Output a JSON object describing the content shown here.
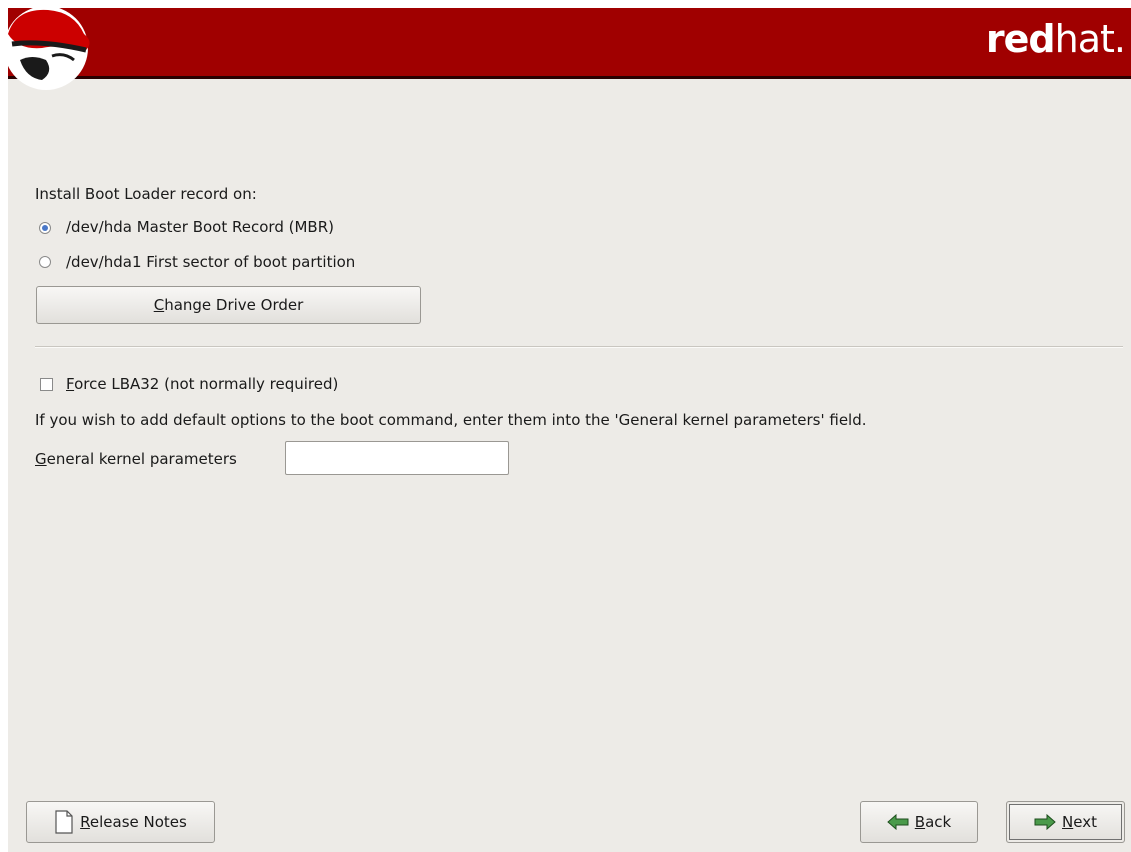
{
  "banner": {
    "brand_bold": "red",
    "brand_light": "hat."
  },
  "bootloader": {
    "heading": "Install Boot Loader record on:",
    "options": [
      {
        "label": "/dev/hda Master Boot Record (MBR)",
        "selected": true
      },
      {
        "label": "/dev/hda1 First sector of boot partition",
        "selected": false
      }
    ],
    "change_order_prefix": "",
    "change_order_mnemonic": "C",
    "change_order_rest": "hange Drive Order"
  },
  "lba": {
    "mnemonic": "F",
    "rest": "orce LBA32 (not normally required)",
    "checked": false
  },
  "kernel": {
    "info": "If you wish to add default options to the boot command, enter them into the 'General kernel parameters' field.",
    "label_mnemonic": "G",
    "label_rest": "eneral kernel parameters",
    "value": ""
  },
  "footer": {
    "release_mnemonic": "R",
    "release_rest": "elease Notes",
    "back_mnemonic": "B",
    "back_rest": "ack",
    "next_mnemonic": "N",
    "next_rest": "ext"
  },
  "colors": {
    "banner": "#a00000",
    "background": "#edebe7",
    "radio_selected": "#4a78c8",
    "arrow_green": "#3a8a3a"
  },
  "icons": {
    "hat_logo": "shadowman-logo",
    "release": "document-icon",
    "back": "arrow-left-icon",
    "next": "arrow-right-icon"
  }
}
